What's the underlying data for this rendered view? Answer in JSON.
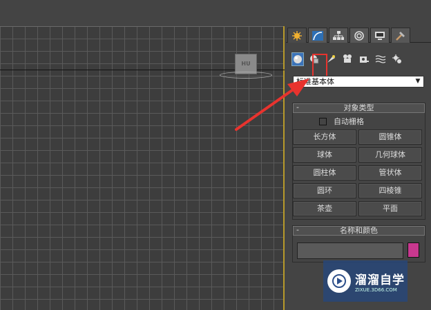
{
  "viewport": {
    "viewcube_label": "HU"
  },
  "panel": {
    "tabs": [
      "create-tab",
      "modify-tab",
      "hierarchy-tab",
      "motion-tab",
      "display-tab",
      "utilities-tab"
    ],
    "category_icons": [
      "geometry-icon",
      "shapes-icon",
      "lights-icon",
      "cameras-icon",
      "helpers-icon",
      "spacewarps-icon",
      "systems-icon"
    ],
    "dropdown_value": "标准基本体",
    "object_type": {
      "title": "对象类型",
      "autogrid_label": "自动栅格",
      "buttons": [
        "长方体",
        "圆锥体",
        "球体",
        "几何球体",
        "圆柱体",
        "管状体",
        "圆环",
        "四棱锥",
        "茶壶",
        "平面"
      ]
    },
    "name_color": {
      "title": "名称和颜色",
      "name_value": "",
      "swatch_color": "#c8388f"
    }
  },
  "watermark": {
    "title": "溜溜自学",
    "subtitle": "ZIXUE.3D66.COM"
  },
  "colors": {
    "highlight": "#e8332e",
    "active_icon": "#3b73b9"
  }
}
